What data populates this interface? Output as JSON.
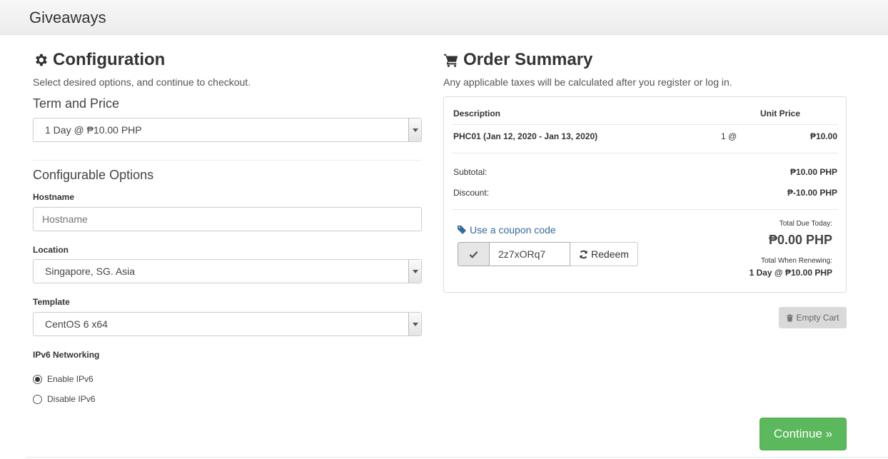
{
  "header": {
    "title": "Giveaways"
  },
  "config": {
    "title": "Configuration",
    "subtitle": "Select desired options, and continue to checkout.",
    "term_label": "Term and Price",
    "term_value": "1 Day @ ₱10.00 PHP",
    "options_title": "Configurable Options",
    "hostname_label": "Hostname",
    "hostname_placeholder": "Hostname",
    "location_label": "Location",
    "location_value": "Singapore, SG. Asia",
    "template_label": "Template",
    "template_value": "CentOS 6 x64",
    "ipv6_label": "IPv6 Networking",
    "ipv6_options": [
      {
        "label": "Enable IPv6",
        "checked": true
      },
      {
        "label": "Disable IPv6",
        "checked": false
      }
    ]
  },
  "summary": {
    "title": "Order Summary",
    "subtitle": "Any applicable taxes will be calculated after you register or log in.",
    "col_description": "Description",
    "col_unit_price": "Unit Price",
    "item_name": "PHC01 (Jan 12, 2020 - Jan 13, 2020)",
    "item_qty": "1 @",
    "item_price": "₱10.00",
    "subtotal_label": "Subtotal:",
    "subtotal_value": "₱10.00 PHP",
    "discount_label": "Discount:",
    "discount_value": "₱-10.00 PHP",
    "coupon_link": "Use a coupon code",
    "coupon_code": "2z7xORq7",
    "redeem_label": "Redeem",
    "total_due_label": "Total Due Today:",
    "total_due_value": "₱0.00 PHP",
    "renewing_label": "Total When Renewing:",
    "renewing_value": "1 Day @ ₱10.00 PHP",
    "empty_cart_label": "Empty Cart",
    "continue_label": "Continue »"
  },
  "colors": {
    "accent_green": "#5cb85c",
    "link_blue": "#3a6a9a"
  }
}
